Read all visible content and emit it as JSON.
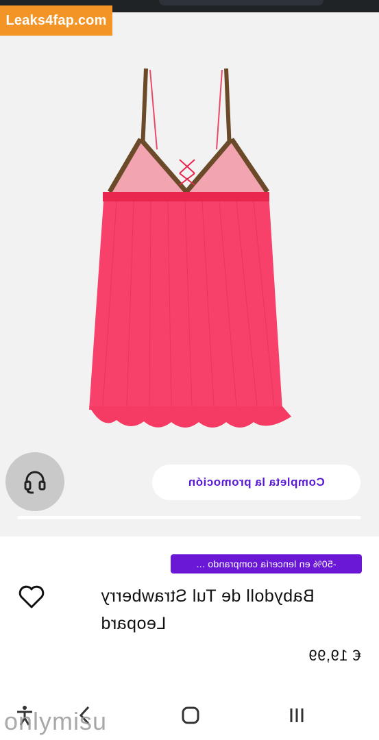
{
  "watermark": {
    "text": "Leaks4fap.com"
  },
  "promo": {
    "cta_label": "Completa la promoción",
    "badge": "-50% en lencería comprando ..."
  },
  "product": {
    "title": "Babydoll de Tul Strawberry Leopard",
    "price": "€ 19,99",
    "image_alt": "babydoll-tul-strawberry-leopard"
  },
  "icons": {
    "support": "headset-icon",
    "wishlist": "heart-icon",
    "nav_accessibility": "accessibility-icon",
    "nav_back": "back-icon",
    "nav_home": "home-icon",
    "nav_recents": "recents-icon"
  },
  "overlay": {
    "bottom_watermark": "onlymisu"
  },
  "colors": {
    "accent_purple": "#6a18d6",
    "garment_pink": "#f53b63",
    "watermark_orange": "#f39426"
  }
}
